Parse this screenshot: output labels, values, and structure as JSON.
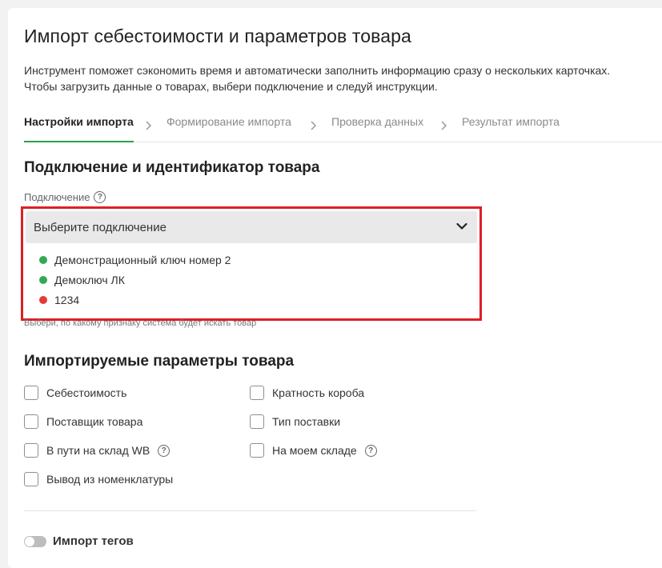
{
  "page": {
    "title": "Импорт себестоимости и параметров товара",
    "description_line1": "Инструмент поможет сэкономить время и автоматически заполнить информацию сразу о нескольких карточках.",
    "description_line2": "Чтобы загрузить данные о товарах, выбери подключение и следуй инструкции."
  },
  "steps": [
    {
      "label": "Настройки импорта",
      "active": true
    },
    {
      "label": "Формирование импорта",
      "active": false
    },
    {
      "label": "Проверка данных",
      "active": false
    },
    {
      "label": "Результат импорта",
      "active": false
    }
  ],
  "connection_section": {
    "heading": "Подключение и идентификатор товара",
    "label": "Подключение",
    "help_glyph": "?",
    "select_placeholder": "Выберите подключение",
    "options": [
      {
        "label": "Демонстрационный ключ номер 2",
        "status_color": "#34a853"
      },
      {
        "label": "Демоключ ЛК",
        "status_color": "#34a853"
      },
      {
        "label": "1234",
        "status_color": "#e53935"
      }
    ],
    "hint": "Выбери, по какому признаку система будет искать товар"
  },
  "params_section": {
    "heading": "Импортируемые параметры товара",
    "left": [
      {
        "label": "Себестоимость",
        "checked": false,
        "help": false
      },
      {
        "label": "Поставщик товара",
        "checked": false,
        "help": false
      },
      {
        "label": "В пути на склад WB",
        "checked": false,
        "help": true
      },
      {
        "label": "Вывод из номенклатуры",
        "checked": false,
        "help": false
      }
    ],
    "right": [
      {
        "label": "Кратность короба",
        "checked": false,
        "help": false
      },
      {
        "label": "Тип поставки",
        "checked": false,
        "help": false
      },
      {
        "label": "На моем складе",
        "checked": false,
        "help": true
      }
    ]
  },
  "tags_toggle": {
    "label": "Импорт тегов",
    "on": false
  },
  "colors": {
    "accent_green": "#2aa24a",
    "highlight_red": "#dc1f26"
  }
}
